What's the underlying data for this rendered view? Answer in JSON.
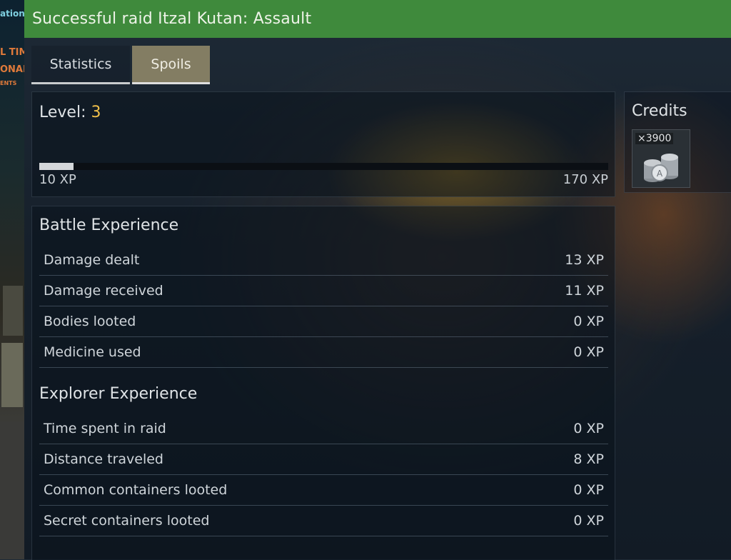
{
  "header": {
    "title": "Successful raid Itzal Kutan: Assault"
  },
  "tabs": [
    {
      "label": "Statistics",
      "active": false
    },
    {
      "label": "Spoils",
      "active": true
    }
  ],
  "level": {
    "label": "Level:",
    "value": "3",
    "current_xp": "10 XP",
    "max_xp": "170 XP",
    "progress_fraction": 0.06
  },
  "credits": {
    "title": "Credits",
    "count": "×3900",
    "icon": "credits-stack-icon"
  },
  "battle_experience": {
    "title": "Battle Experience",
    "rows": [
      {
        "label": "Damage dealt",
        "value": "13 XP"
      },
      {
        "label": "Damage received",
        "value": "11 XP"
      },
      {
        "label": "Bodies looted",
        "value": "0 XP"
      },
      {
        "label": "Medicine used",
        "value": "0 XP"
      }
    ]
  },
  "explorer_experience": {
    "title": "Explorer Experience",
    "rows": [
      {
        "label": "Time spent in raid",
        "value": "0 XP"
      },
      {
        "label": "Distance traveled",
        "value": "8 XP"
      },
      {
        "label": "Common containers looted",
        "value": "0 XP"
      },
      {
        "label": "Secret containers looted",
        "value": "0 XP"
      }
    ]
  },
  "background_signs": [
    "ation",
    "L TIM",
    "ONAL",
    "ENTS"
  ],
  "colors": {
    "header_green": "#3f8a3c",
    "level_value": "#f0c04a",
    "active_tab": "#837d63"
  }
}
